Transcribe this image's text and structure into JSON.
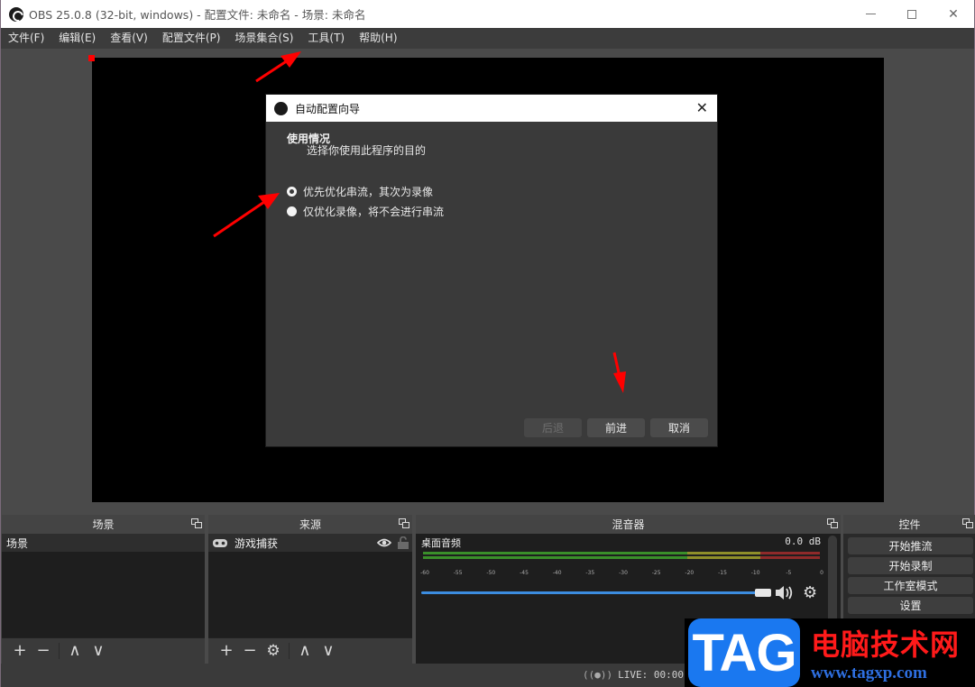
{
  "window": {
    "title": "OBS 25.0.8 (32-bit, windows) - 配置文件: 未命名 - 场景: 未命名",
    "controls": {
      "minimize": "—",
      "maximize": "□",
      "close": "✕"
    }
  },
  "menubar": {
    "items": [
      {
        "label": "文件(F)"
      },
      {
        "label": "编辑(E)"
      },
      {
        "label": "查看(V)"
      },
      {
        "label": "配置文件(P)"
      },
      {
        "label": "场景集合(S)"
      },
      {
        "label": "工具(T)"
      },
      {
        "label": "帮助(H)"
      }
    ]
  },
  "dialog": {
    "title": "自动配置向导",
    "close": "✕",
    "heading": "使用情况",
    "subheading": "选择你使用此程序的目的",
    "options": [
      {
        "label": "优先优化串流，其次为录像",
        "selected": true
      },
      {
        "label": "仅优化录像，将不会进行串流",
        "selected": false
      }
    ],
    "buttons": {
      "back": "后退",
      "next": "前进",
      "cancel": "取消"
    }
  },
  "docks": {
    "scenes": {
      "title": "场景",
      "items": [
        {
          "label": "场景"
        }
      ],
      "toolbar": {
        "add": "+",
        "remove": "−",
        "up": "∧",
        "down": "∨"
      }
    },
    "sources": {
      "title": "来源",
      "items": [
        {
          "label": "游戏捕获",
          "icon": "gamepad-icon",
          "visible": true,
          "locked": false
        }
      ],
      "toolbar": {
        "add": "+",
        "remove": "−",
        "settings": "⚙",
        "up": "∧",
        "down": "∨"
      }
    },
    "mixer": {
      "title": "混音器",
      "channels": [
        {
          "name": "桌面音频",
          "level": "0.0 dB",
          "volume_percent": 100
        }
      ],
      "ticks": [
        "-60",
        "-55",
        "-50",
        "-45",
        "-40",
        "-35",
        "-30",
        "-25",
        "-20",
        "-15",
        "-10",
        "-5",
        "0"
      ]
    },
    "controls": {
      "title": "控件",
      "buttons": [
        {
          "label": "开始推流"
        },
        {
          "label": "开始录制"
        },
        {
          "label": "工作室模式"
        },
        {
          "label": "设置"
        }
      ]
    }
  },
  "statusbar": {
    "live": "LIVE: 00:00:00"
  },
  "watermark": {
    "tag": "TAG",
    "site_name": "电脑技术网",
    "url": "www.tagxp.com"
  },
  "colors": {
    "annotation_red": "#ff0000",
    "volume_blue": "#3c8de0",
    "watermark_blue": "#1a78f0"
  }
}
